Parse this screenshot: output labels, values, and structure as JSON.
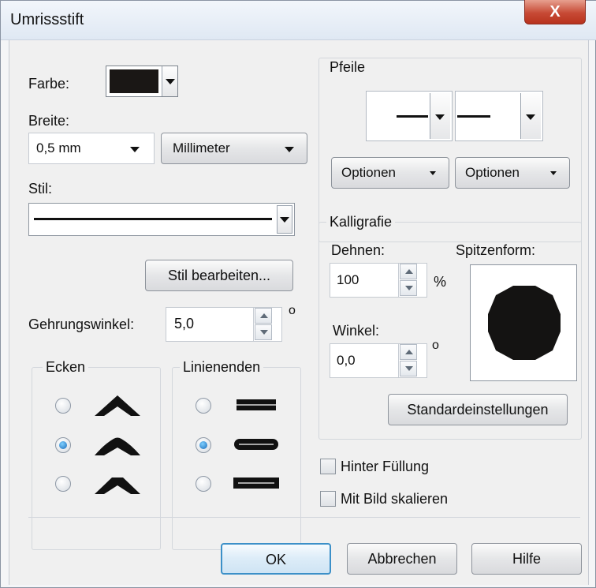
{
  "window": {
    "title": "Umrissstift",
    "close_glyph": "X"
  },
  "farbe": {
    "label": "Farbe:",
    "value_color": "#1a1715"
  },
  "breite": {
    "label": "Breite:",
    "value": "0,5 mm",
    "unit": "Millimeter"
  },
  "stil": {
    "label": "Stil:",
    "edit_button": "Stil bearbeiten..."
  },
  "gehrung": {
    "label": "Gehrungswinkel:",
    "value": "5,0",
    "unit": "o"
  },
  "ecken": {
    "label": "Ecken",
    "selected_index": 1,
    "options": [
      "miter-corner-icon",
      "round-corner-icon",
      "bevel-corner-icon"
    ]
  },
  "linienenden": {
    "label": "Linienenden",
    "selected_index": 1,
    "options": [
      "butt-cap-icon",
      "round-cap-icon",
      "square-cap-icon"
    ]
  },
  "pfeile": {
    "label": "Pfeile",
    "options_left": "Optionen",
    "options_right": "Optionen"
  },
  "kalligrafie": {
    "label": "Kalligrafie",
    "dehnen_label": "Dehnen:",
    "dehnen_value": "100",
    "dehnen_unit": "%",
    "spitzenform_label": "Spitzenform:",
    "winkel_label": "Winkel:",
    "winkel_value": "0,0",
    "winkel_unit": "o",
    "default_button": "Standardeinstellungen"
  },
  "checkboxes": {
    "hinter_fuellung": "Hinter Füllung",
    "mit_bild": "Mit Bild skalieren"
  },
  "footer": {
    "ok": "OK",
    "cancel": "Abbrechen",
    "help": "Hilfe"
  },
  "colors": {
    "accent_ok_border": "#3c90c8",
    "window_bg": "#f0f0f0",
    "close_red": "#c74a35"
  }
}
